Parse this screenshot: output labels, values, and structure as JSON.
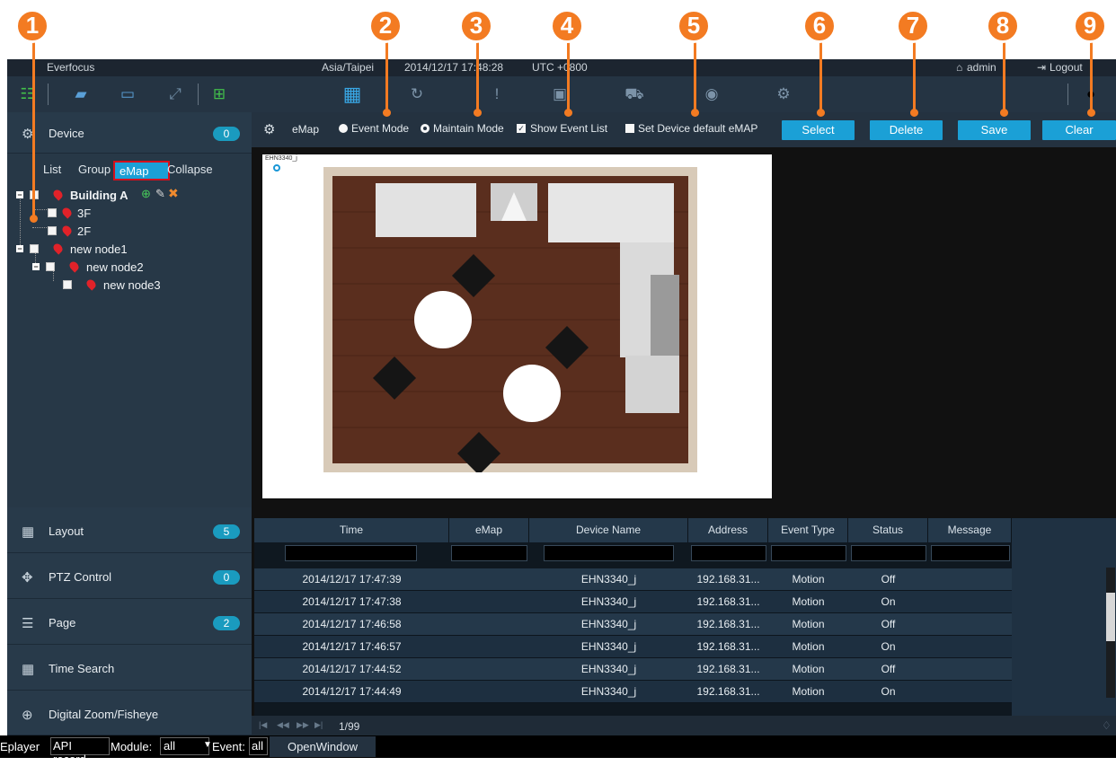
{
  "topbar": {
    "app_name": "Everfocus",
    "timezone": "Asia/Taipei",
    "datetime": "2014/12/17 17:48:28",
    "utc": "UTC +0800",
    "user": "admin",
    "logout": "Logout"
  },
  "toolbar": {
    "icons": [
      "list-view-icon",
      "multi-window-icon",
      "monitor-icon",
      "fullscreen-icon",
      "split-icon",
      "layout-grid-icon",
      "playback-icon",
      "alarm-icon",
      "camera-event-icon",
      "vehicle-icon",
      "face-icon",
      "settings-icon",
      "theme-toggle-icon"
    ]
  },
  "sidebar": {
    "device": {
      "label": "Device",
      "badge": "0"
    },
    "tabs": [
      "List",
      "Group",
      "eMap",
      "Collapse"
    ],
    "tree": {
      "building": "Building A",
      "floor1": "3F",
      "floor2": "2F",
      "node1": "new node1",
      "node2": "new node2",
      "node3": "new node3"
    },
    "sections": [
      {
        "label": "Layout",
        "badge": "5",
        "icon": "layout-icon"
      },
      {
        "label": "PTZ Control",
        "badge": "0",
        "icon": "ptz-icon"
      },
      {
        "label": "Page",
        "badge": "2",
        "icon": "page-icon"
      },
      {
        "label": "Time Search",
        "icon": "calendar-icon"
      },
      {
        "label": "Digital Zoom/Fisheye",
        "icon": "zoom-icon"
      }
    ]
  },
  "emap": {
    "title": "eMap",
    "event_mode": "Event Mode",
    "maintain_mode": "Maintain Mode",
    "show_event_list": "Show Event List",
    "set_default": "Set Device default eMAP",
    "buttons": {
      "select": "Select",
      "delete": "Delete",
      "save": "Save",
      "clear": "Clear"
    },
    "device_label": "EHN3340_j"
  },
  "table": {
    "columns": [
      "Time",
      "eMap",
      "Device Name",
      "Address",
      "Event Type",
      "Status",
      "Message"
    ],
    "rows": [
      [
        "2014/12/17 17:47:39",
        "",
        "EHN3340_j",
        "192.168.31...",
        "Motion",
        "Off",
        ""
      ],
      [
        "2014/12/17 17:47:38",
        "",
        "EHN3340_j",
        "192.168.31...",
        "Motion",
        "On",
        ""
      ],
      [
        "2014/12/17 17:46:58",
        "",
        "EHN3340_j",
        "192.168.31...",
        "Motion",
        "Off",
        ""
      ],
      [
        "2014/12/17 17:46:57",
        "",
        "EHN3340_j",
        "192.168.31...",
        "Motion",
        "On",
        ""
      ],
      [
        "2014/12/17 17:44:52",
        "",
        "EHN3340_j",
        "192.168.31...",
        "Motion",
        "Off",
        ""
      ],
      [
        "2014/12/17 17:44:49",
        "",
        "EHN3340_j",
        "192.168.31...",
        "Motion",
        "On",
        ""
      ]
    ],
    "pager": "1/99"
  },
  "bottom": {
    "eplayer": "Eplayer",
    "api": "API record",
    "module_label": "Module:",
    "module_value": "all",
    "event_label": "Event:",
    "event_value": "all",
    "open_window": "OpenWindow"
  },
  "callouts": [
    "1",
    "2",
    "3",
    "4",
    "5",
    "6",
    "7",
    "8",
    "9"
  ],
  "colors": {
    "accent": "#1ba0d6",
    "callout": "#f37b22",
    "pin": "#e12229"
  }
}
